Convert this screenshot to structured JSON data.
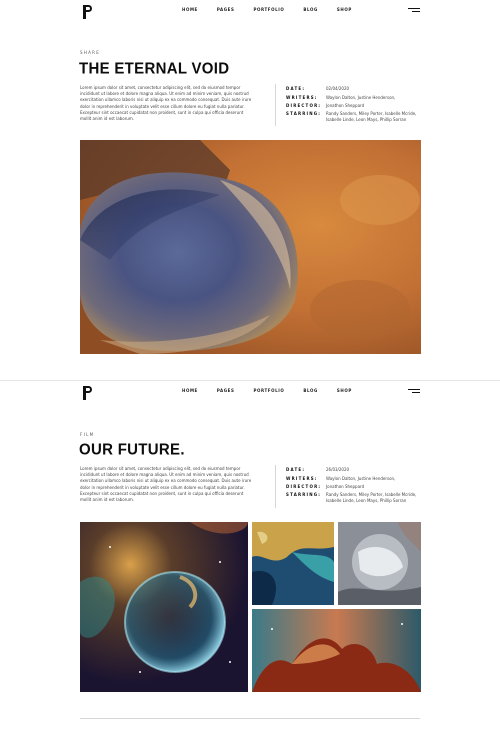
{
  "header": {
    "nav": [
      "HOME",
      "PAGES",
      "PORTFOLIO",
      "BLOG",
      "SHOP"
    ]
  },
  "project1": {
    "category": "SHARE",
    "title": "THE ETERNAL VOID",
    "description": "Lorem ipsum dolor sit amet, consectetur adipiscing elit, sed do eiusmod tempor incididunt ut labore et dolore magna aliqua. Ut enim ad minim veniam, quis nostrud exercitation ullamco laboris nisi ut aliquip ex ea commodo consequat. Duis aute irure dolor in reprehenderit in voluptate velit esse cillum dolore eu fugiat nulla pariatur. Excepteur sint occaecat cupidatat non proident, sunt in culpa qui officia deserunt mollit anim id est laborum.",
    "meta": [
      {
        "label": "DATE:",
        "value": "02/04/2020"
      },
      {
        "label": "WRITERS:",
        "value": "Waylon Dalton, Justine Henderson,"
      },
      {
        "label": "DIRECTOR:",
        "value": "Jonathon Sheppard"
      },
      {
        "label": "STARRING:",
        "value": "Randy Sanders, Miley Porter, Isabelle Mcride, Isabelle Linde, Leon Mays, Phillip Sorran"
      }
    ]
  },
  "project2": {
    "category": "FILM",
    "title": "OUR FUTURE.",
    "description": "Lorem ipsum dolor sit amet, consectetur adipiscing elit, sed do eiusmod tempor incididunt ut labore et dolore magna aliqua. Ut enim ad minim veniam, quis nostrud exercitation ullamco laboris nisi ut aliquip ex ea commodo consequat. Duis aute irure dolor in reprehenderit in voluptate velit esse cillum dolore eu fugiat nulla pariatur. Excepteur sint occaecat cupidatat non proident, sunt in culpa qui officia deserunt mollit anim id est laborum.",
    "meta": [
      {
        "label": "DATE:",
        "value": "26/03/2020"
      },
      {
        "label": "WRITERS:",
        "value": "Waylon Dalton, Justine Henderson,"
      },
      {
        "label": "DIRECTOR:",
        "value": "Jonathon Sheppard"
      },
      {
        "label": "STARRING:",
        "value": "Randy Sanders, Miley Porter, Isabelle Mcride, Isabelle Linde, Leon Mays, Phillip Sorran"
      }
    ]
  },
  "icons": {
    "logo": "p-logo-icon",
    "menu": "hamburger-menu-icon"
  }
}
